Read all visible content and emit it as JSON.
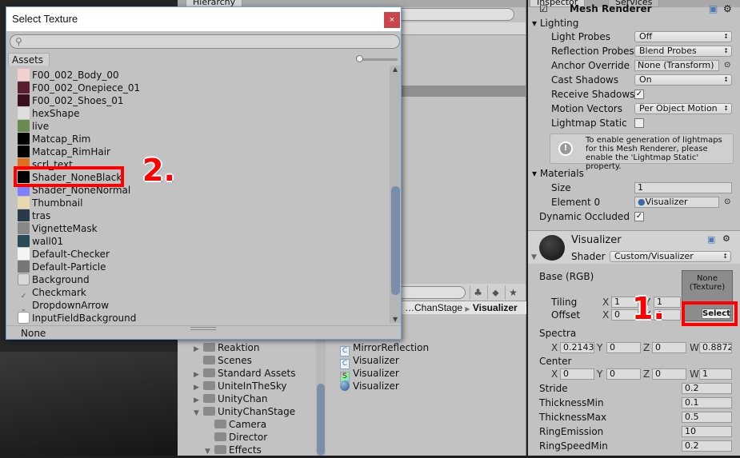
{
  "hierarchy": {
    "tab": "Hierarchy"
  },
  "project": {
    "breadcrumb_prefix": "…ChanStage",
    "breadcrumb_current": "Visualizer",
    "folders": [
      {
        "label": "Reaktion",
        "expanded": false,
        "indent": 0
      },
      {
        "label": "Scenes",
        "expanded": null,
        "indent": 0
      },
      {
        "label": "Standard Assets",
        "expanded": false,
        "indent": 0
      },
      {
        "label": "UniteInTheSky",
        "expanded": false,
        "indent": 0
      },
      {
        "label": "UnityChan",
        "expanded": false,
        "indent": 0
      },
      {
        "label": "UnityChanStage",
        "expanded": true,
        "indent": 0
      },
      {
        "label": "Camera",
        "expanded": null,
        "indent": 1
      },
      {
        "label": "Director",
        "expanded": null,
        "indent": 1
      },
      {
        "label": "Effects",
        "expanded": true,
        "indent": 1
      }
    ],
    "files": [
      {
        "label": "MirrorReflection",
        "icon": "csharp-script-icon"
      },
      {
        "label": "Visualizer",
        "icon": "csharp-script-icon"
      },
      {
        "label": "Visualizer",
        "icon": "shader-icon"
      },
      {
        "label": "Visualizer",
        "icon": "material-icon"
      }
    ]
  },
  "inspector": {
    "tabs": [
      "Inspector",
      "Services"
    ],
    "component": "Mesh Renderer",
    "lighting": {
      "header": "Lighting",
      "light_probes": {
        "label": "Light Probes",
        "value": "Off"
      },
      "reflection_probes": {
        "label": "Reflection Probes",
        "value": "Blend Probes"
      },
      "anchor_override": {
        "label": "Anchor Override",
        "value": "None (Transform)"
      },
      "cast_shadows": {
        "label": "Cast Shadows",
        "value": "On"
      },
      "receive_shadows": {
        "label": "Receive Shadows",
        "checked": true
      },
      "motion_vectors": {
        "label": "Motion Vectors",
        "value": "Per Object Motion"
      },
      "lightmap_static": {
        "label": "Lightmap Static",
        "checked": false
      },
      "help": "To enable generation of lightmaps for this Mesh Renderer, please enable the 'Lightmap Static' property."
    },
    "materials": {
      "header": "Materials",
      "size_label": "Size",
      "size": "1",
      "element_label": "Element 0",
      "element": "Visualizer"
    },
    "dynamic_occluded": {
      "label": "Dynamic Occluded",
      "checked": true
    },
    "material": {
      "name": "Visualizer",
      "shader_label": "Shader",
      "shader": "Custom/Visualizer",
      "base_label": "Base (RGB)",
      "texture": "None\n(Texture)",
      "texture_line1": "None",
      "texture_line2": "(Texture)",
      "select": "Select",
      "tiling_label": "Tiling",
      "tiling_x": "1",
      "tiling_y": "1",
      "offset_label": "Offset",
      "offset_x": "0",
      "offset_y": "0",
      "spectra_label": "Spectra",
      "spectra": {
        "x": "0.2143",
        "y": "0",
        "z": "0",
        "w": "0.8872"
      },
      "center_label": "Center",
      "center": {
        "x": "0",
        "y": "0",
        "z": "0",
        "w": "1"
      },
      "props": [
        {
          "label": "Stride",
          "value": "0.2"
        },
        {
          "label": "ThicknessMin",
          "value": "0.1"
        },
        {
          "label": "ThicknessMax",
          "value": "0.5"
        },
        {
          "label": "RingEmission",
          "value": "10"
        },
        {
          "label": "RingSpeedMin",
          "value": "0.2"
        }
      ]
    }
  },
  "dialog": {
    "title": "Select Texture",
    "close": "×",
    "search_placeholder": "",
    "assets_tab": "Assets",
    "items": [
      {
        "label": "F00_002_Body_00",
        "thumb": "#f3d0d0"
      },
      {
        "label": "F00_002_Onepiece_01",
        "thumb": "#5a2030"
      },
      {
        "label": "F00_002_Shoes_01",
        "thumb": "#3a1020"
      },
      {
        "label": "hexShape",
        "thumb": "#dddddd"
      },
      {
        "label": "live",
        "thumb": "#6a8a50"
      },
      {
        "label": "Matcap_Rim",
        "thumb": "#000000"
      },
      {
        "label": "Matcap_RimHair",
        "thumb": "#000000"
      },
      {
        "label": "scrl_text",
        "thumb": "#e07020"
      },
      {
        "label": "Shader_NoneBlack",
        "thumb": "#000000"
      },
      {
        "label": "Shader_NoneNormal",
        "thumb": "#8080ff"
      },
      {
        "label": "Thumbnail",
        "thumb": "#e8d8b0"
      },
      {
        "label": "tras",
        "thumb": "#2a3a4a"
      },
      {
        "label": "VignetteMask",
        "thumb": "#888888"
      },
      {
        "label": "wall01",
        "thumb": "#2a4a55"
      },
      {
        "label": "Default-Checker",
        "thumb": "#f4f4f4"
      },
      {
        "label": "Default-Particle",
        "thumb": "#777777"
      },
      {
        "label": "Background",
        "thumb": "#d8d8d8"
      },
      {
        "label": "Checkmark",
        "thumb": "check"
      },
      {
        "label": "DropdownArrow",
        "thumb": "arrow"
      },
      {
        "label": "InputFieldBackground",
        "thumb": "#ffffff"
      }
    ],
    "bottom": "None"
  },
  "annotations": {
    "step1": "1.",
    "step2": "2.",
    "color": "#ff0000"
  }
}
